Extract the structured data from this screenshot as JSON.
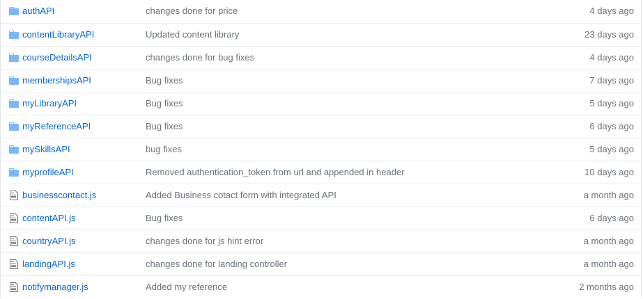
{
  "colors": {
    "link": "#0366d6",
    "folder_icon": "#79b8ff",
    "file_icon": "#6a737d",
    "muted_text": "#6a737d",
    "row_border": "#eaecef"
  },
  "files": [
    {
      "type": "folder",
      "icon": "folder-icon",
      "name": "authAPI",
      "message": "changes done for price",
      "age": "4 days ago"
    },
    {
      "type": "folder",
      "icon": "folder-icon",
      "name": "contentLibraryAPI",
      "message": "Updated content library",
      "age": "23 days ago"
    },
    {
      "type": "folder",
      "icon": "folder-icon",
      "name": "courseDetailsAPI",
      "message": "changes done for bug fixes",
      "age": "4 days ago"
    },
    {
      "type": "folder",
      "icon": "folder-icon",
      "name": "membershipsAPI",
      "message": "Bug fixes",
      "age": "7 days ago"
    },
    {
      "type": "folder",
      "icon": "folder-icon",
      "name": "myLibraryAPI",
      "message": "Bug fixes",
      "age": "5 days ago"
    },
    {
      "type": "folder",
      "icon": "folder-icon",
      "name": "myReferenceAPI",
      "message": "Bug fixes",
      "age": "6 days ago"
    },
    {
      "type": "folder",
      "icon": "folder-icon",
      "name": "mySkillsAPI",
      "message": "bug fixes",
      "age": "5 days ago"
    },
    {
      "type": "folder",
      "icon": "folder-icon",
      "name": "myprofileAPI",
      "message": "Removed authentication_token from url and appended in header",
      "age": "10 days ago"
    },
    {
      "type": "file",
      "icon": "file-icon",
      "name": "businesscontact.js",
      "message": "Added Business cotact form with integrated API",
      "age": "a month ago"
    },
    {
      "type": "file",
      "icon": "file-icon",
      "name": "contentAPI.js",
      "message": "Bug fixes",
      "age": "6 days ago"
    },
    {
      "type": "file",
      "icon": "file-icon",
      "name": "countryAPI.js",
      "message": "changes done for js hint error",
      "age": "a month ago"
    },
    {
      "type": "file",
      "icon": "file-icon",
      "name": "landingAPI.js",
      "message": "changes done for landing controller",
      "age": "a month ago"
    },
    {
      "type": "file",
      "icon": "file-icon",
      "name": "notifymanager.js",
      "message": "Added my reference",
      "age": "2 months ago"
    }
  ]
}
